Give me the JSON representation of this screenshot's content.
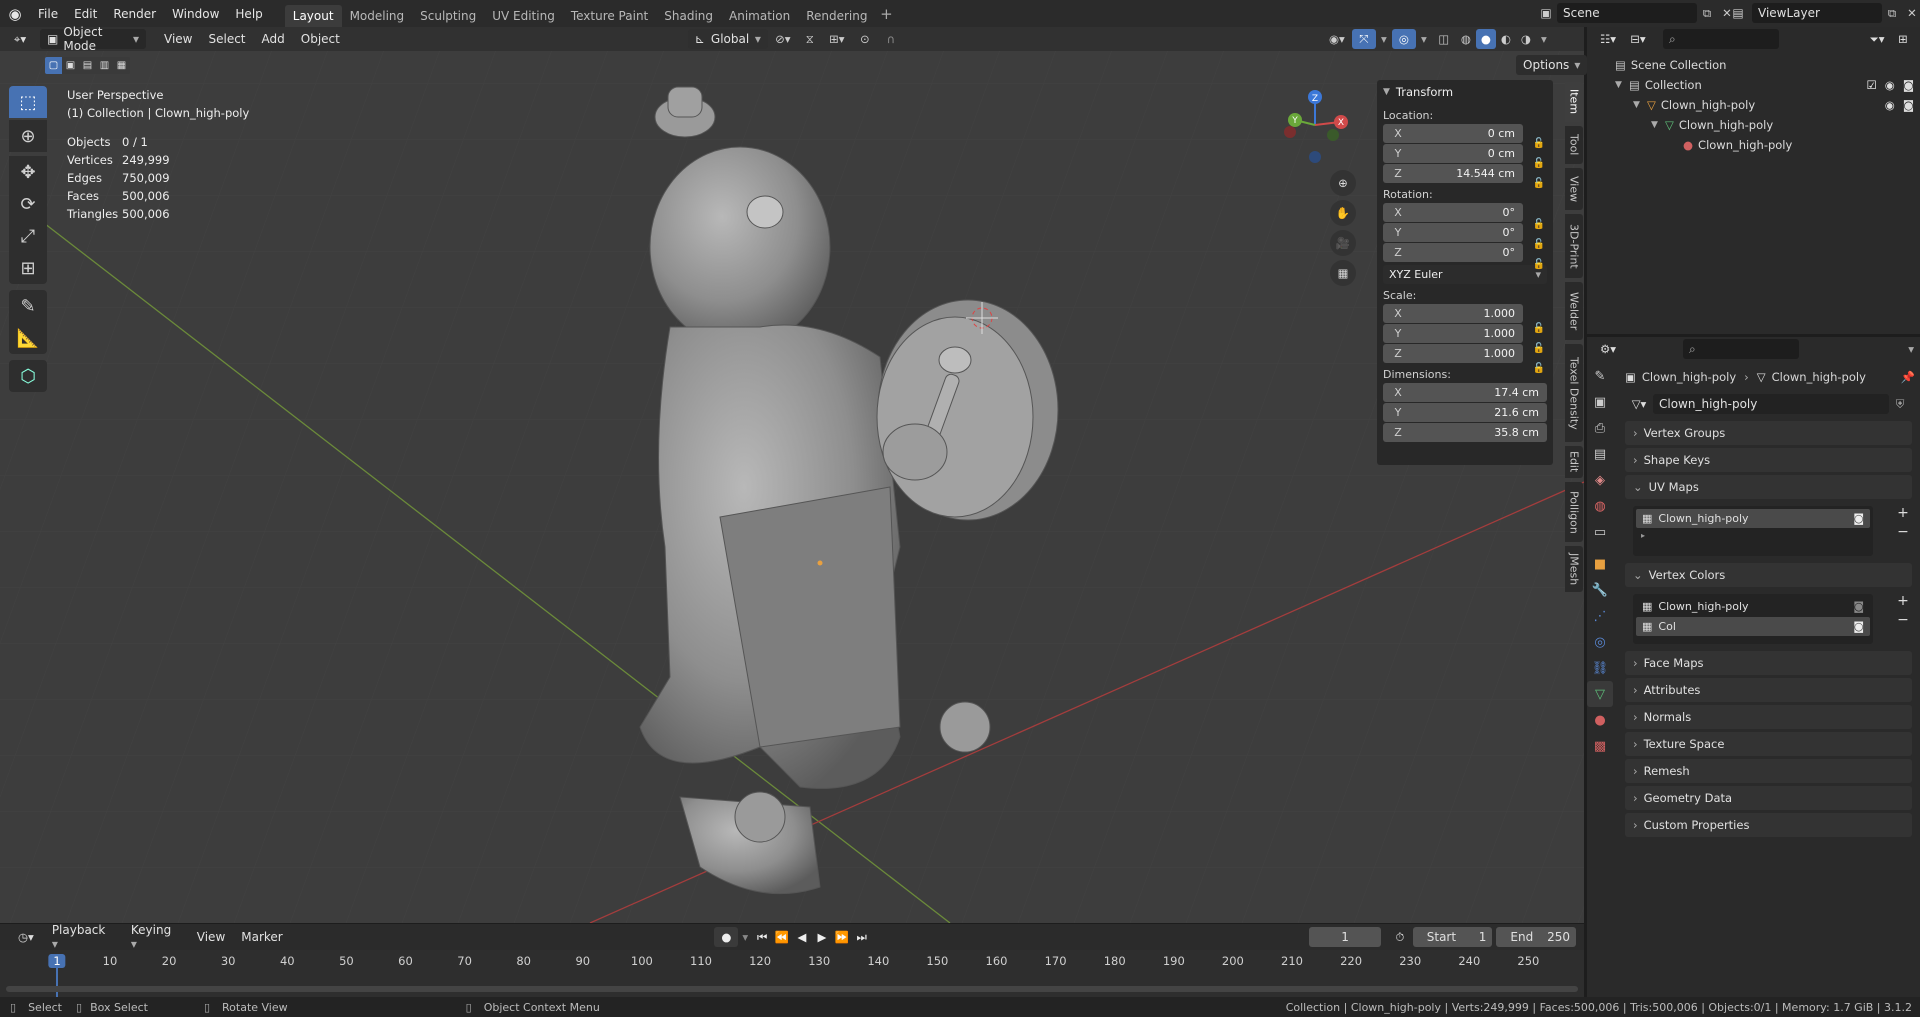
{
  "topbar": {
    "menus": [
      "File",
      "Edit",
      "Render",
      "Window",
      "Help"
    ],
    "workspaces": [
      "Layout",
      "Modeling",
      "Sculpting",
      "UV Editing",
      "Texture Paint",
      "Shading",
      "Animation",
      "Rendering"
    ],
    "active_workspace": "Layout",
    "scene": "Scene",
    "view_layer": "ViewLayer"
  },
  "viewport_header": {
    "mode": "Object Mode",
    "menus": [
      "View",
      "Select",
      "Add",
      "Object"
    ],
    "orientation": "Global",
    "options": "Options"
  },
  "overlay": {
    "perspective": "User Perspective",
    "collection": "(1) Collection | Clown_high-poly",
    "stats": [
      {
        "label": "Objects",
        "value": "0 / 1"
      },
      {
        "label": "Vertices",
        "value": "249,999"
      },
      {
        "label": "Edges",
        "value": "750,009"
      },
      {
        "label": "Faces",
        "value": "500,006"
      },
      {
        "label": "Triangles",
        "value": "500,006"
      }
    ]
  },
  "gizmo": {
    "x": "X",
    "y": "Y",
    "z": "Z"
  },
  "npanel": {
    "title": "Transform",
    "location_label": "Location:",
    "location": [
      {
        "axis": "X",
        "value": "0 cm"
      },
      {
        "axis": "Y",
        "value": "0 cm"
      },
      {
        "axis": "Z",
        "value": "14.544 cm"
      }
    ],
    "rotation_label": "Rotation:",
    "rotation": [
      {
        "axis": "X",
        "value": "0°"
      },
      {
        "axis": "Y",
        "value": "0°"
      },
      {
        "axis": "Z",
        "value": "0°"
      }
    ],
    "rotation_mode": "XYZ Euler",
    "scale_label": "Scale:",
    "scale": [
      {
        "axis": "X",
        "value": "1.000"
      },
      {
        "axis": "Y",
        "value": "1.000"
      },
      {
        "axis": "Z",
        "value": "1.000"
      }
    ],
    "dimensions_label": "Dimensions:",
    "dimensions": [
      {
        "axis": "X",
        "value": "17.4 cm"
      },
      {
        "axis": "Y",
        "value": "21.6 cm"
      },
      {
        "axis": "Z",
        "value": "35.8 cm"
      }
    ]
  },
  "side_tabs": [
    "Item",
    "Tool",
    "View",
    "3D-Print",
    "Welder",
    "Texel Density",
    "Edit",
    "Polligon",
    "JMesh"
  ],
  "outliner": {
    "rows": [
      "Scene Collection",
      "Collection",
      "Clown_high-poly",
      "Clown_high-poly",
      "Clown_high-poly"
    ]
  },
  "properties": {
    "breadcrumb_object": "Clown_high-poly",
    "breadcrumb_data": "Clown_high-poly",
    "mesh_name": "Clown_high-poly",
    "panels_top": [
      "Vertex Groups",
      "Shape Keys"
    ],
    "uv_maps_title": "UV Maps",
    "uv_maps": [
      "Clown_high-poly"
    ],
    "vertex_colors_title": "Vertex Colors",
    "vertex_colors": [
      "Clown_high-poly",
      "Col"
    ],
    "panels_bottom": [
      "Face Maps",
      "Attributes",
      "Normals",
      "Texture Space",
      "Remesh",
      "Geometry Data",
      "Custom Properties"
    ]
  },
  "timeline": {
    "menus": [
      "Playback",
      "Keying",
      "View",
      "Marker"
    ],
    "current_frame": "1",
    "start_label": "Start",
    "start": "1",
    "end_label": "End",
    "end": "250",
    "ticks": [
      "1",
      "10",
      "20",
      "30",
      "40",
      "50",
      "60",
      "70",
      "80",
      "90",
      "100",
      "110",
      "120",
      "130",
      "140",
      "150",
      "160",
      "170",
      "180",
      "190",
      "200",
      "210",
      "220",
      "230",
      "240",
      "250"
    ]
  },
  "statusbar": {
    "select": "Select",
    "box_select": "Box Select",
    "rotate": "Rotate View",
    "context": "Object Context Menu",
    "info": "Collection | Clown_high-poly | Verts:249,999 | Faces:500,006 | Tris:500,006 | Objects:0/1 | Memory: 1.7 GiB | 3.1.2"
  }
}
